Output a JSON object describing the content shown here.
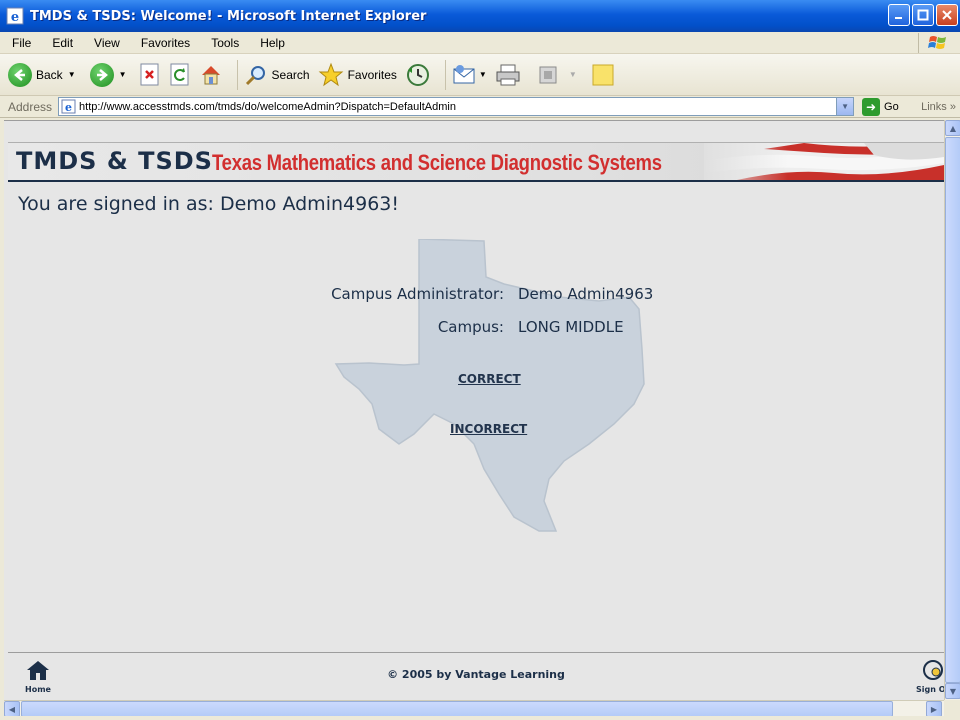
{
  "window": {
    "title": "TMDS & TSDS: Welcome! - Microsoft Internet Explorer"
  },
  "menu": [
    "File",
    "Edit",
    "View",
    "Favorites",
    "Tools",
    "Help"
  ],
  "toolbar": {
    "back_label": "Back",
    "search_label": "Search",
    "favorites_label": "Favorites"
  },
  "address": {
    "label": "Address",
    "url": "http://www.accesstmds.com/tmds/do/welcomeAdmin?Dispatch=DefaultAdmin",
    "go_label": "Go",
    "links_label": "Links"
  },
  "banner": {
    "brand": "TMDS & TSDS",
    "tagline": "Texas Mathematics and Science Diagnostic Systems"
  },
  "page": {
    "signed_in": "You are signed in as: Demo Admin4963!",
    "role_label": "Campus Administrator:",
    "role_value": "Demo Admin4963",
    "campus_label": "Campus:",
    "campus_value": "LONG MIDDLE",
    "correct_link": "CORRECT",
    "incorrect_link": "INCORRECT"
  },
  "footer": {
    "copyright": "© 2005 by Vantage Learning",
    "home_label": "Home",
    "signout_label": "Sign Out"
  },
  "colors": {
    "title_blue": "#0a5ad9",
    "navy_text": "#1c2f48",
    "banner_red": "#d22f2f",
    "texas_shape": "#c9d2dc"
  }
}
